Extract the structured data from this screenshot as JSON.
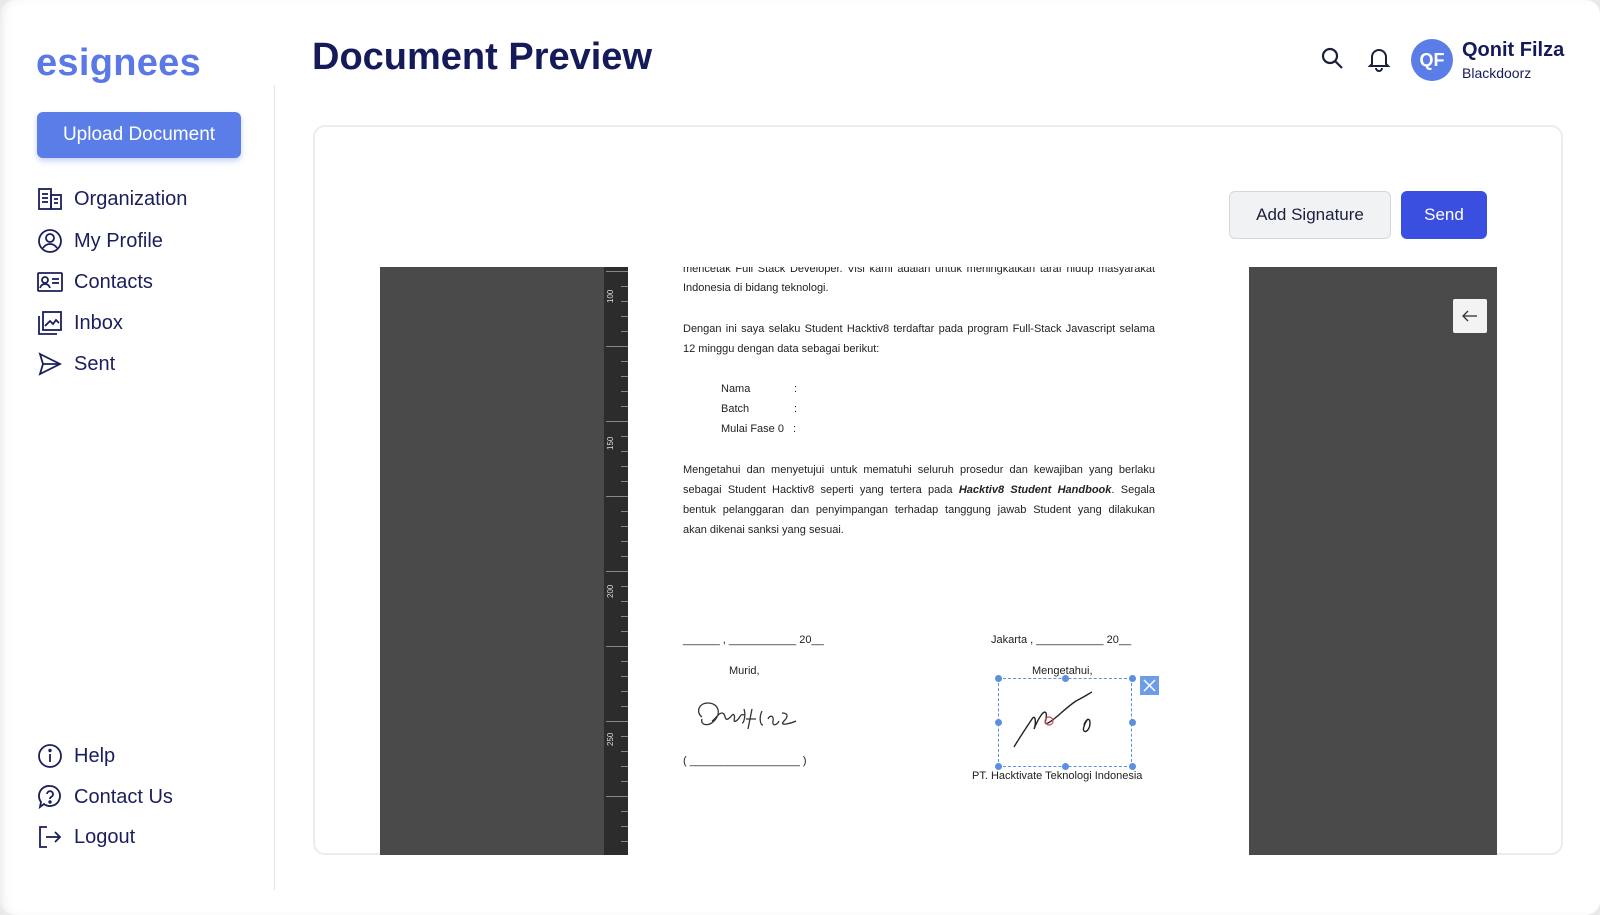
{
  "app": {
    "logo": "esignees",
    "upload_label": "Upload Document"
  },
  "sidebar": {
    "items": [
      {
        "label": "Organization",
        "icon": "building-icon"
      },
      {
        "label": "My Profile",
        "icon": "user-circle-icon"
      },
      {
        "label": "Contacts",
        "icon": "contact-card-icon"
      },
      {
        "label": "Inbox",
        "icon": "inbox-icon"
      },
      {
        "label": "Sent",
        "icon": "send-icon"
      }
    ],
    "bottom_items": [
      {
        "label": "Help",
        "icon": "info-icon"
      },
      {
        "label": "Contact Us",
        "icon": "question-icon"
      },
      {
        "label": "Logout",
        "icon": "logout-icon"
      }
    ]
  },
  "header": {
    "title": "Document Preview",
    "user_initials": "QF",
    "user_name": "Qonit Filza",
    "user_org": "Blackdoorz"
  },
  "actions": {
    "add_signature": "Add Signature",
    "send": "Send"
  },
  "ruler": {
    "labels": [
      "100",
      "150",
      "200",
      "250"
    ]
  },
  "document": {
    "line1": "mencetak Full Stack Developer. Visi kami adalah untuk meningkatkan taraf hidup masyarakat",
    "line2": "Indonesia di bidang  teknologi.",
    "para2_line1": "Dengan ini saya selaku Student Hacktiv8 terdaftar pada program Full-Stack Javascript selama",
    "para2_line2": "12 minggu dengan data sebagai berikut:",
    "field_nama": "Nama",
    "field_batch": "Batch",
    "field_fase": "Mulai Fase 0",
    "colon": ":",
    "para3_line1": "Mengetahui dan menyetujui untuk mematuhi seluruh prosedur dan kewajiban yang berlaku",
    "para3_line2_a": "sebagai Student Hacktiv8 seperti yang tertera pada",
    "para3_line2_b": "Hacktiv8 Student Handbook",
    "para3_line2_c": ". Segala",
    "para3_line3": "bentuk pelanggaran dan penyimpangan terhadap tanggung jawab Student yang dilakukan",
    "para3_line4": "akan dikenai sanksi yang sesuai.",
    "date_left": "______ , ___________ 20__",
    "date_right": "Jakarta , ___________ 20__",
    "murid": "Murid,",
    "mengetahui": "Mengetahui,",
    "sig_line_left": "( __________________ )",
    "company": "PT. Hacktivate Teknologi Indonesia",
    "student_signature": "Qonit Filza"
  },
  "colors": {
    "primary": "#5b7de8",
    "send": "#3a4fe0",
    "title": "#151a5a",
    "viewer_bg": "#4a4a4a"
  }
}
